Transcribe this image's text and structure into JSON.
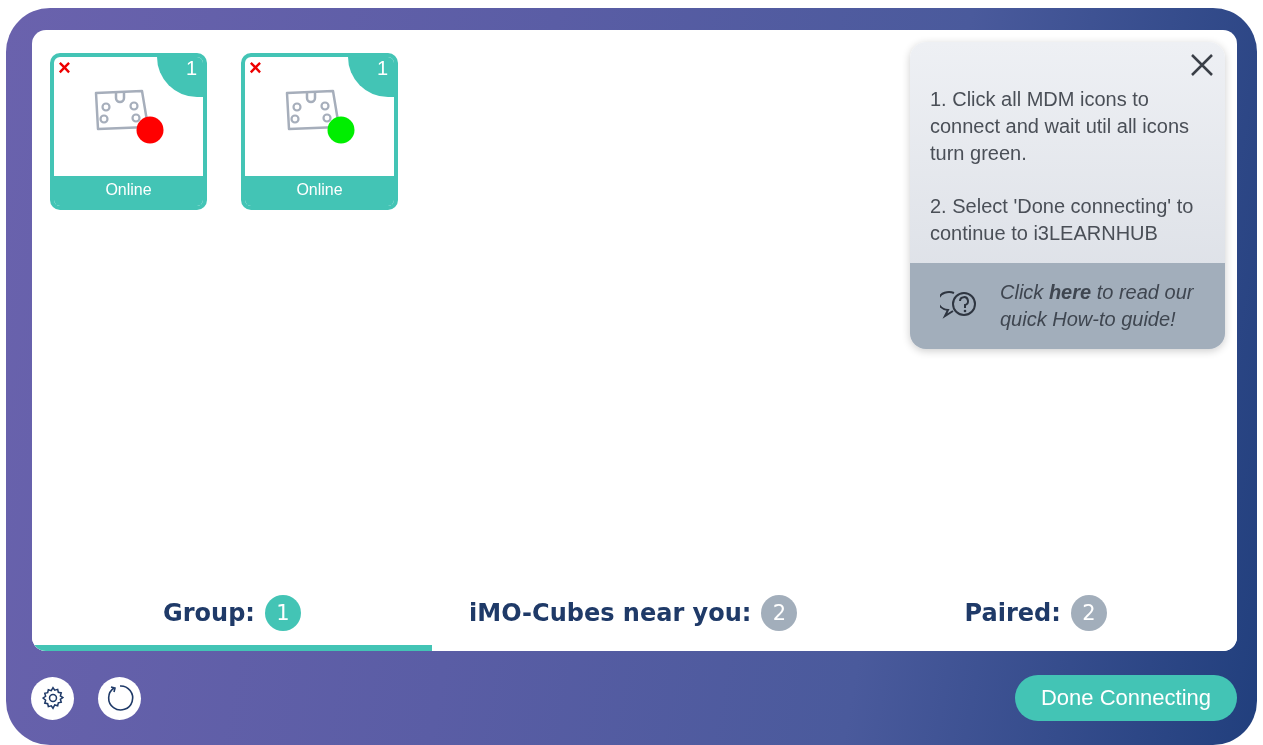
{
  "devices": [
    {
      "remove": "×",
      "number": "1",
      "status": "Online",
      "color": "#ff0000"
    },
    {
      "remove": "×",
      "number": "1",
      "status": "Online",
      "color": "#00ee00"
    }
  ],
  "help": {
    "steps": [
      "1. Click all MDM icons to connect and wait util all icons turn green.",
      "2. Select 'Done connecting' to continue to i3LEARNHUB"
    ],
    "guide": "Click **here** to read our quick How-to guide!"
  },
  "tabs": [
    {
      "label": "Group:",
      "count": "1",
      "selected": true
    },
    {
      "label": "iMO-Cubes near you:",
      "count": "2",
      "selected": false
    },
    {
      "label": "Paired:",
      "count": "2",
      "selected": false
    }
  ],
  "done_button": "Done Connecting"
}
